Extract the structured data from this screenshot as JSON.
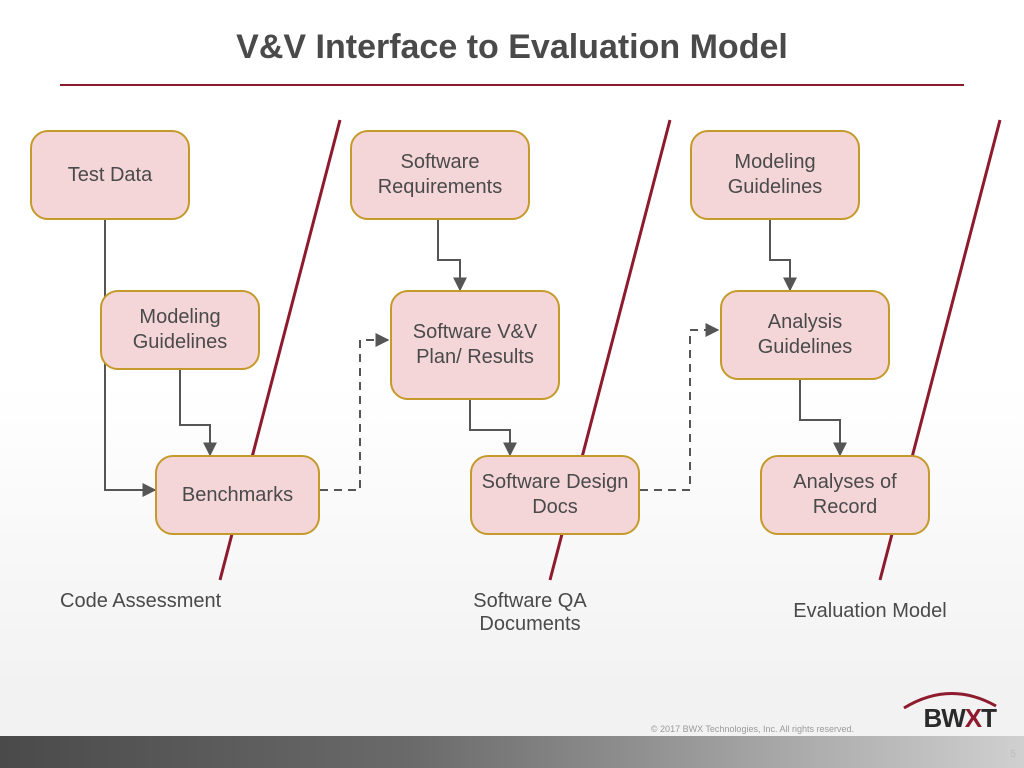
{
  "title": "V&V Interface to Evaluation Model",
  "nodes": {
    "test_data": "Test Data",
    "modeling_guidelines_1": "Modeling Guidelines",
    "benchmarks": "Benchmarks",
    "software_requirements": "Software Requirements",
    "software_vv_plan": "Software V&V Plan/ Results",
    "software_design_docs": "Software Design Docs",
    "modeling_guidelines_2": "Modeling Guidelines",
    "analysis_guidelines": "Analysis Guidelines",
    "analyses_of_record": "Analyses of Record"
  },
  "sections": {
    "code_assessment": "Code Assessment",
    "software_qa": "Software QA Documents",
    "evaluation_model": "Evaluation Model"
  },
  "footer": {
    "copyright": "© 2017 BWX Technologies, Inc. All rights reserved.",
    "logo_bw": "BW",
    "logo_x": "X",
    "logo_t": "T",
    "page_number": "5"
  }
}
